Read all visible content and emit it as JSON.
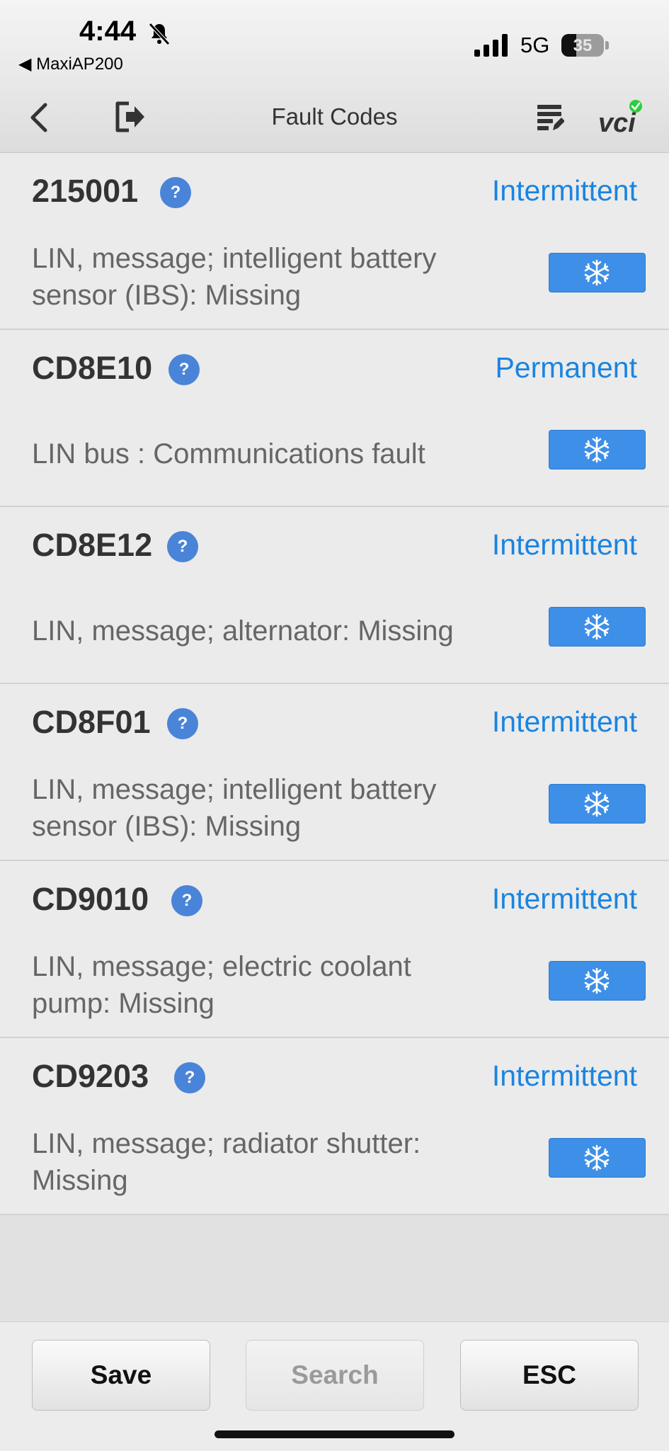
{
  "status_bar": {
    "time": "4:44",
    "back_app": "MaxiAP200",
    "network": "5G",
    "battery_percent": "35",
    "battery_level": 0.35
  },
  "nav": {
    "title": "Fault Codes"
  },
  "faults": [
    {
      "code": "215001",
      "status": "Intermittent",
      "description": "LIN, message; intelligent battery sensor (IBS): Missing"
    },
    {
      "code": "CD8E10",
      "status": "Permanent",
      "description": "LIN bus : Communications fault"
    },
    {
      "code": "CD8E12",
      "status": "Intermittent",
      "description": "LIN, message; alternator: Missing"
    },
    {
      "code": "CD8F01",
      "status": "Intermittent",
      "description": "LIN, message; intelligent battery sensor (IBS): Missing"
    },
    {
      "code": "CD9010",
      "status": "Intermittent",
      "description": "LIN, message; electric coolant pump: Missing"
    },
    {
      "code": "CD9203",
      "status": "Intermittent",
      "description": "LIN, message; radiator shutter: Missing"
    }
  ],
  "help_label": "?",
  "footer": {
    "save": "Save",
    "search": "Search",
    "esc": "ESC"
  },
  "colors": {
    "status": "#1a84e0",
    "help_badge": "#4a84d8",
    "freeze_button": "#3d8fe7",
    "vci_badge": "#2ecc40"
  }
}
